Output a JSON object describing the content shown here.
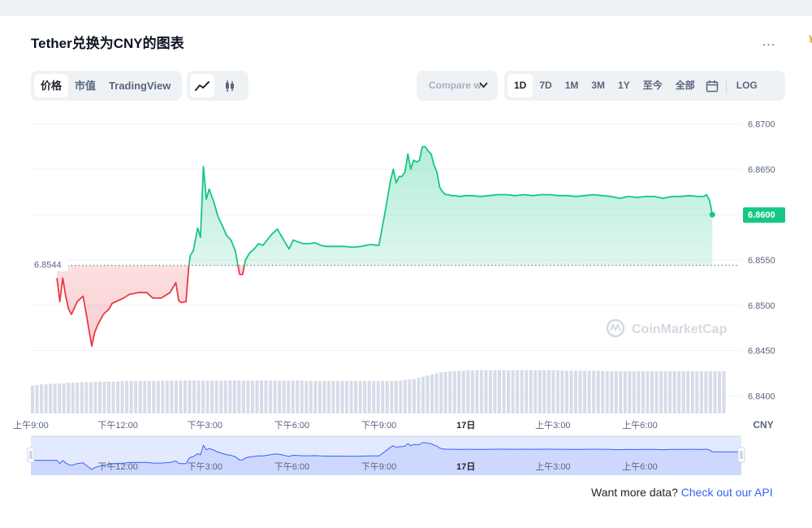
{
  "page": {
    "title": "Tether兑换为CNY的图表",
    "more_label": "...",
    "corner_glyph": "¥"
  },
  "type_tabs": [
    {
      "label": "价格",
      "active": true
    },
    {
      "label": "市值",
      "active": false
    },
    {
      "label": "TradingView",
      "active": false
    }
  ],
  "chart_type_icons": [
    {
      "icon": "line-chart-icon",
      "active": true
    },
    {
      "icon": "candlestick-icon",
      "active": false
    }
  ],
  "compare": {
    "label": "Compare w"
  },
  "range_tabs": [
    {
      "label": "1D",
      "active": true
    },
    {
      "label": "7D",
      "active": false
    },
    {
      "label": "1M",
      "active": false
    },
    {
      "label": "3M",
      "active": false
    },
    {
      "label": "1Y",
      "active": false
    },
    {
      "label": "至今",
      "active": false
    },
    {
      "label": "全部",
      "active": false
    }
  ],
  "range_extra": {
    "calendar_icon": "calendar-icon",
    "log_label": "LOG"
  },
  "watermark": "CoinMarketCap",
  "api_prompt": {
    "text": "Want more data? ",
    "link": "Check out our API"
  },
  "colors": {
    "up": "#16c784",
    "down": "#ea3943",
    "navigator": "#3861fb",
    "text_muted": "#58667e"
  },
  "chart_data": {
    "type": "area",
    "currency_label": "CNY",
    "baseline": 6.8544,
    "baseline_label": "6.8544",
    "current_price": 6.86,
    "current_label": "6.8600",
    "ylim": [
      6.8395,
      6.8705
    ],
    "y_ticks": [
      6.87,
      6.865,
      6.86,
      6.855,
      6.85,
      6.845,
      6.84
    ],
    "y_tick_labels": [
      "6.8700",
      "6.8650",
      "6.8600",
      "6.8550",
      "6.8500",
      "6.8450",
      "6.8400"
    ],
    "x_range": [
      0,
      24.5
    ],
    "x_ticks": [
      {
        "t": 0,
        "label": "上午9:00",
        "bold": false
      },
      {
        "t": 3,
        "label": "下午12:00",
        "bold": false
      },
      {
        "t": 6,
        "label": "下午3:00",
        "bold": false
      },
      {
        "t": 9,
        "label": "下午6:00",
        "bold": false
      },
      {
        "t": 12,
        "label": "下午9:00",
        "bold": false
      },
      {
        "t": 15,
        "label": "17日",
        "bold": true
      },
      {
        "t": 18,
        "label": "上午3:00",
        "bold": false
      },
      {
        "t": 21,
        "label": "上午6:00",
        "bold": false
      }
    ],
    "navigator_ticks": [
      {
        "t": 3,
        "label": "下午12:00",
        "bold": false
      },
      {
        "t": 6,
        "label": "下午3:00",
        "bold": false
      },
      {
        "t": 9,
        "label": "下午6:00",
        "bold": false
      },
      {
        "t": 12,
        "label": "下午9:00",
        "bold": false
      },
      {
        "t": 15,
        "label": "17日",
        "bold": true
      },
      {
        "t": 18,
        "label": "上午3:00",
        "bold": false
      },
      {
        "t": 21,
        "label": "上午6:00",
        "bold": false
      }
    ],
    "series": [
      {
        "x": [
          0.9,
          1.0,
          1.1,
          1.2,
          1.3,
          1.4,
          1.6,
          1.8,
          1.9,
          2.1,
          2.2,
          2.3,
          2.5,
          2.7,
          2.8,
          3.0,
          3.2,
          3.4,
          3.7,
          4.0,
          4.2,
          4.5,
          4.8,
          5.0,
          5.1,
          5.2,
          5.35,
          5.45,
          5.5,
          5.6,
          5.75,
          5.85,
          5.95,
          6.05,
          6.15,
          6.3,
          6.45,
          6.6,
          6.75,
          6.9,
          7.05,
          7.2,
          7.3,
          7.4,
          7.55,
          7.7,
          7.85,
          8.0,
          8.15,
          8.3,
          8.5,
          8.7,
          8.9,
          9.05,
          9.2,
          9.4,
          9.6,
          9.8,
          10.0,
          10.2,
          10.5,
          10.8,
          11.1,
          11.4,
          11.7,
          12.0,
          12.2,
          12.4,
          12.5,
          12.6,
          12.7,
          12.8,
          12.9,
          13.0,
          13.1,
          13.2,
          13.3,
          13.4,
          13.5,
          13.6,
          13.7,
          13.8,
          13.9,
          14.0,
          14.1,
          14.2,
          14.3,
          14.4,
          14.5,
          14.6,
          14.8,
          15.0,
          15.2,
          15.5,
          15.8,
          16.1,
          16.4,
          16.7,
          17.0,
          17.3,
          17.6,
          17.9,
          18.2,
          18.5,
          18.8,
          19.1,
          19.4,
          19.7,
          20.0,
          20.3,
          20.6,
          20.9,
          21.2,
          21.5,
          21.8,
          22.1,
          22.4,
          22.7,
          23.0,
          23.2,
          23.3,
          23.4,
          23.5
        ],
        "y": [
          6.853,
          6.8504,
          6.853,
          6.851,
          6.8496,
          6.849,
          6.8504,
          6.851,
          6.8492,
          6.8455,
          6.847,
          6.8478,
          6.849,
          6.8496,
          6.8502,
          6.8505,
          6.8508,
          6.8512,
          6.8514,
          6.8514,
          6.8508,
          6.8508,
          6.8514,
          6.8525,
          6.8505,
          6.8503,
          6.8504,
          6.8544,
          6.8555,
          6.856,
          6.8585,
          6.8575,
          6.8653,
          6.8617,
          6.8628,
          6.8615,
          6.8598,
          6.8588,
          6.8577,
          6.8572,
          6.856,
          6.8534,
          6.8534,
          6.855,
          6.8558,
          6.8562,
          6.8568,
          6.8566,
          6.8572,
          6.8578,
          6.8584,
          6.8573,
          6.8562,
          6.8572,
          6.857,
          6.8568,
          6.8568,
          6.8569,
          6.8566,
          6.8565,
          6.8565,
          6.8565,
          6.8564,
          6.8565,
          6.8567,
          6.8566,
          6.86,
          6.8638,
          6.865,
          6.8635,
          6.8642,
          6.8642,
          6.8647,
          6.8667,
          6.865,
          6.866,
          6.8658,
          6.866,
          6.8675,
          6.8675,
          6.867,
          6.8667,
          6.8655,
          6.8647,
          6.863,
          6.8625,
          6.8622,
          6.8622,
          6.8621,
          6.8621,
          6.862,
          6.8621,
          6.8621,
          6.862,
          6.8621,
          6.8622,
          6.8622,
          6.8621,
          6.8622,
          6.8621,
          6.8622,
          6.8622,
          6.8621,
          6.8621,
          6.862,
          6.8621,
          6.8622,
          6.8621,
          6.862,
          6.8618,
          6.862,
          6.8619,
          6.862,
          6.862,
          6.8618,
          6.862,
          6.862,
          6.8621,
          6.862,
          6.862,
          6.8622,
          6.8616,
          6.86
        ]
      }
    ],
    "volume": [
      0.52,
      0.53,
      0.54,
      0.54,
      0.55,
      0.55,
      0.56,
      0.56,
      0.57,
      0.57,
      0.57,
      0.58,
      0.58,
      0.58,
      0.58,
      0.59,
      0.59,
      0.59,
      0.59,
      0.59,
      0.6,
      0.6,
      0.6,
      0.6,
      0.6,
      0.6,
      0.6,
      0.6,
      0.6,
      0.61,
      0.61,
      0.61,
      0.61,
      0.61,
      0.61,
      0.61,
      0.61,
      0.61,
      0.61,
      0.61,
      0.61,
      0.61,
      0.61,
      0.61,
      0.61,
      0.61,
      0.61,
      0.61,
      0.61,
      0.61,
      0.61,
      0.61,
      0.61,
      0.61,
      0.61,
      0.61,
      0.61,
      0.61,
      0.61,
      0.61,
      0.61,
      0.6,
      0.6,
      0.6,
      0.6,
      0.6,
      0.6,
      0.6,
      0.6,
      0.6,
      0.6,
      0.6,
      0.6,
      0.6,
      0.6,
      0.6,
      0.6,
      0.6,
      0.6,
      0.6,
      0.6,
      0.6,
      0.61,
      0.62,
      0.63,
      0.64,
      0.66,
      0.68,
      0.7,
      0.72,
      0.74,
      0.76,
      0.77,
      0.78,
      0.78,
      0.79,
      0.79,
      0.8,
      0.8,
      0.8,
      0.8,
      0.8,
      0.8,
      0.8,
      0.8,
      0.8,
      0.8,
      0.8,
      0.8,
      0.8,
      0.8,
      0.8,
      0.8,
      0.8,
      0.8,
      0.8,
      0.8,
      0.8,
      0.8,
      0.79,
      0.79,
      0.79,
      0.79,
      0.79,
      0.79,
      0.79,
      0.79,
      0.79,
      0.78,
      0.78,
      0.78,
      0.78,
      0.78,
      0.78,
      0.78,
      0.78,
      0.78,
      0.78,
      0.78,
      0.78,
      0.78,
      0.78,
      0.78,
      0.78,
      0.78,
      0.78,
      0.78,
      0.78,
      0.78,
      0.78,
      0.78,
      0.78,
      0.78,
      0.78,
      0.78
    ]
  }
}
